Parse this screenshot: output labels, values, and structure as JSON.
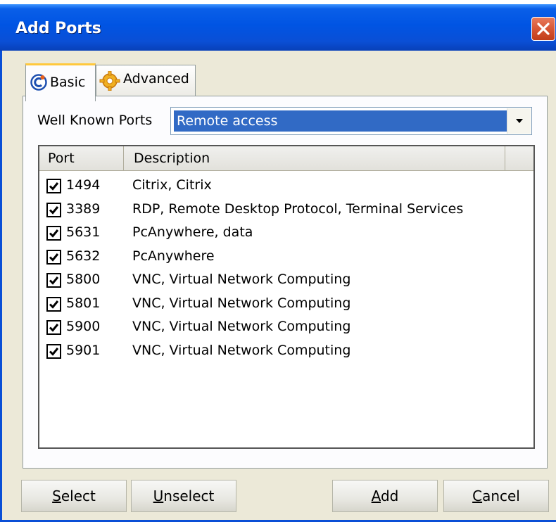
{
  "window": {
    "title": "Add Ports"
  },
  "tabs": [
    {
      "label": "Basic",
      "icon": "c-logo-icon",
      "selected": true
    },
    {
      "label": "Advanced",
      "icon": "gear-icon",
      "selected": false
    }
  ],
  "well_known_ports": {
    "label": "Well Known Ports",
    "selected": "Remote access"
  },
  "table": {
    "columns": [
      "Port",
      "Description"
    ],
    "rows": [
      {
        "checked": true,
        "port": "1494",
        "description": "Citrix, Citrix"
      },
      {
        "checked": true,
        "port": "3389",
        "description": "RDP, Remote Desktop Protocol, Terminal Services"
      },
      {
        "checked": true,
        "port": "5631",
        "description": "PcAnywhere, data"
      },
      {
        "checked": true,
        "port": "5632",
        "description": "PcAnywhere"
      },
      {
        "checked": true,
        "port": "5800",
        "description": "VNC, Virtual Network Computing"
      },
      {
        "checked": true,
        "port": "5801",
        "description": "VNC, Virtual Network Computing"
      },
      {
        "checked": true,
        "port": "5900",
        "description": "VNC, Virtual Network Computing"
      },
      {
        "checked": true,
        "port": "5901",
        "description": "VNC, Virtual Network Computing"
      }
    ]
  },
  "buttons": {
    "select": {
      "underline": "S",
      "rest": "elect"
    },
    "unselect": {
      "underline": "U",
      "rest": "nselect"
    },
    "add": {
      "underline": "A",
      "rest": "dd"
    },
    "cancel": {
      "underline": "C",
      "rest": "ancel"
    }
  },
  "colors": {
    "titlebar": "#0054e3",
    "selection": "#316ac5",
    "close": "#d3502e"
  }
}
